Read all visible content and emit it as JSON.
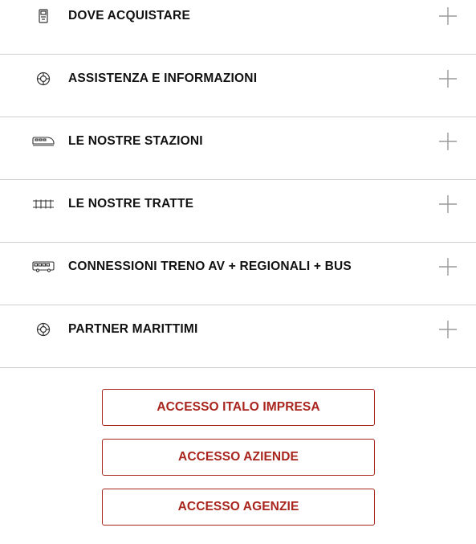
{
  "accordion": {
    "items": [
      {
        "label": "DOVE ACQUISTARE",
        "icon": "ticket-machine-icon"
      },
      {
        "label": "ASSISTENZA E INFORMAZIONI",
        "icon": "lifebuoy-icon"
      },
      {
        "label": "LE NOSTRE STAZIONI",
        "icon": "train-icon"
      },
      {
        "label": "LE NOSTRE TRATTE",
        "icon": "rail-track-icon"
      },
      {
        "label": "CONNESSIONI TRENO AV + REGIONALI + BUS",
        "icon": "bus-icon"
      },
      {
        "label": "PARTNER MARITTIMI",
        "icon": "lifebuoy-icon"
      }
    ],
    "expand_icon": "plus-icon"
  },
  "buttons": {
    "items": [
      {
        "label": "ACCESSO ITALO IMPRESA"
      },
      {
        "label": "ACCESSO AZIENDE"
      },
      {
        "label": "ACCESSO AGENZIE"
      }
    ]
  },
  "colors": {
    "accent": "#a8241c",
    "text": "#111111",
    "divider": "#cfcfcf",
    "icon": "#333333",
    "plus": "#9a9a9a"
  }
}
